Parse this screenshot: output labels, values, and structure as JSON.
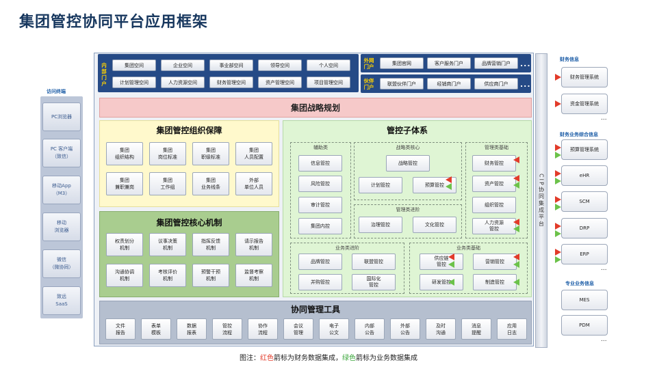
{
  "title": "集团管控协同平台应用框架",
  "colors": {
    "finance_flag": "#e23b2a",
    "business_flag": "#6cc24a",
    "nav": "#254a86",
    "strategy": "#f6c9c9",
    "org_panel": "#fff9cc",
    "mech_panel": "#a9cd8f",
    "control_panel": "#dff5d4",
    "tools_bar": "#b5bfcf"
  },
  "left": {
    "label": "访问终端",
    "items": [
      "PC浏览器",
      "PC 客户端\n（致信）",
      "移动App\n（M3）",
      "移动\n浏览器",
      "微信\n（微协同）",
      "致远\nSaaS"
    ]
  },
  "portal_inner": {
    "label": "内部\n门户",
    "row1": [
      "集团空间",
      "企业空间",
      "事业部空间",
      "领导空间",
      "个人空间"
    ],
    "row2": [
      "计划管理空间",
      "人力资源空间",
      "财务管理空间",
      "资产管理空间",
      "项目管理空间"
    ]
  },
  "portal_outer": {
    "label": "外网\n门户",
    "items": [
      "集团官网",
      "客户服务门户",
      "品牌营销门户"
    ],
    "more": "..."
  },
  "portal_partner": {
    "label": "伙伴\n门户",
    "items": [
      "联盟伙伴门户",
      "经销商门户",
      "供应商门户"
    ],
    "more": "..."
  },
  "strategy": "集团战略规划",
  "org": {
    "title": "集团管控组织保障",
    "items": [
      "集团\n组织结构",
      "集团\n岗位标准",
      "集团\n职级标准",
      "集团\n人员配置",
      "集团\n兼职兼岗",
      "集团\n工作组",
      "集团\n业务线条",
      "外部\n单位人员"
    ]
  },
  "mechanism": {
    "title": "集团管控核心机制",
    "items": [
      "权责划分\n机制",
      "议事决策\n机制",
      "指挥反馈\n机制",
      "请示报告\n机制",
      "沟通协调\n机制",
      "考核评价\n机制",
      "预警干预\n机制",
      "监督考察\n机制"
    ]
  },
  "control": {
    "title": "管控子体系",
    "aux": {
      "label": "辅助类",
      "items": [
        "信息管控",
        "风险管控",
        "审计管控",
        "集团内控"
      ]
    },
    "strategy_core": {
      "label": "战略类核心",
      "items": [
        "战略管控",
        "计划管控",
        "预算管控"
      ]
    },
    "mgmt_adv": {
      "label": "管理类进阶",
      "items": [
        "治理管控",
        "文化管控"
      ]
    },
    "mgmt_base": {
      "label": "管理类基础",
      "items": [
        "财务管控",
        "资产管控",
        "组织管控",
        "人力资源\n管控"
      ]
    },
    "biz_adv": {
      "label": "业务类进阶",
      "items": [
        "品牌管控",
        "联盟管控",
        "并购管控",
        "国际化\n管控"
      ]
    },
    "biz_base": {
      "label": "业务类基础",
      "items": [
        "供应链\n管控",
        "营销管控",
        "研发管控",
        "制造管控"
      ]
    }
  },
  "tools": {
    "title": "协同管理工具",
    "items": [
      "文件\n报告",
      "表单\n模板",
      "数据\n报表",
      "管控\n流程",
      "协作\n流程",
      "会议\n管理",
      "电子\n公文",
      "内部\n公告",
      "外部\n公告",
      "及时\n沟通",
      "消息\n提醒",
      "应用\n日志"
    ]
  },
  "cip": "CIP协同集成平台",
  "right": {
    "finance_label": "财务信息",
    "finance_items": [
      "财务管理系统",
      "资金管理系统"
    ],
    "biz_label": "财务业务综合信息",
    "biz_items": [
      "预算管理系统",
      "eHR",
      "SCM",
      "DRP",
      "ERP"
    ],
    "pro_label": "专业业务信息",
    "pro_items": [
      "MES",
      "PDM"
    ],
    "more": "..."
  },
  "caption": {
    "prefix": "图注：",
    "red": "红色",
    "mid": "箭标为财务数据集成，",
    "green": "绿色",
    "suffix": "箭标为业务数据集成"
  }
}
